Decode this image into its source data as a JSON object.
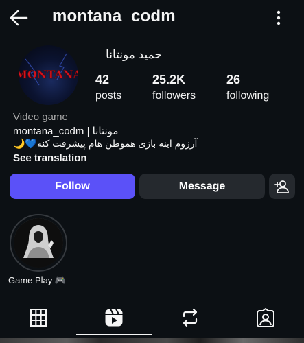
{
  "header": {
    "username": "montana_codm"
  },
  "profile": {
    "avatar_text": "MONTANA",
    "display_name": "حمید مونتانا",
    "stats": {
      "posts_count": "42",
      "posts_label": "posts",
      "followers_count": "25.2K",
      "followers_label": "followers",
      "following_count": "26",
      "following_label": "following"
    },
    "category": "Video game",
    "bio_line1": "montana_codm | مونتانا",
    "bio_line2": "🌙💙آرزوم اینه بازی هموطن هام پیشرفت کنه",
    "see_translation": "See translation"
  },
  "actions": {
    "follow_label": "Follow",
    "message_label": "Message"
  },
  "highlights": [
    {
      "label": "Game Play 🎮"
    }
  ],
  "tabs": [
    "grid",
    "reels",
    "reposts",
    "tagged"
  ],
  "colors": {
    "background": "#0c1014",
    "follow_button": "#5b51f8",
    "secondary_button": "#25292e",
    "muted_text": "#a8a8a8",
    "avatar_logo_red": "#d3121c"
  },
  "icons": {
    "back": "arrow-left-icon",
    "more": "more-vertical-icon",
    "add_user": "add-user-icon",
    "grid": "grid-icon",
    "reels": "reels-icon",
    "reposts": "repost-icon",
    "tagged": "tagged-icon"
  }
}
